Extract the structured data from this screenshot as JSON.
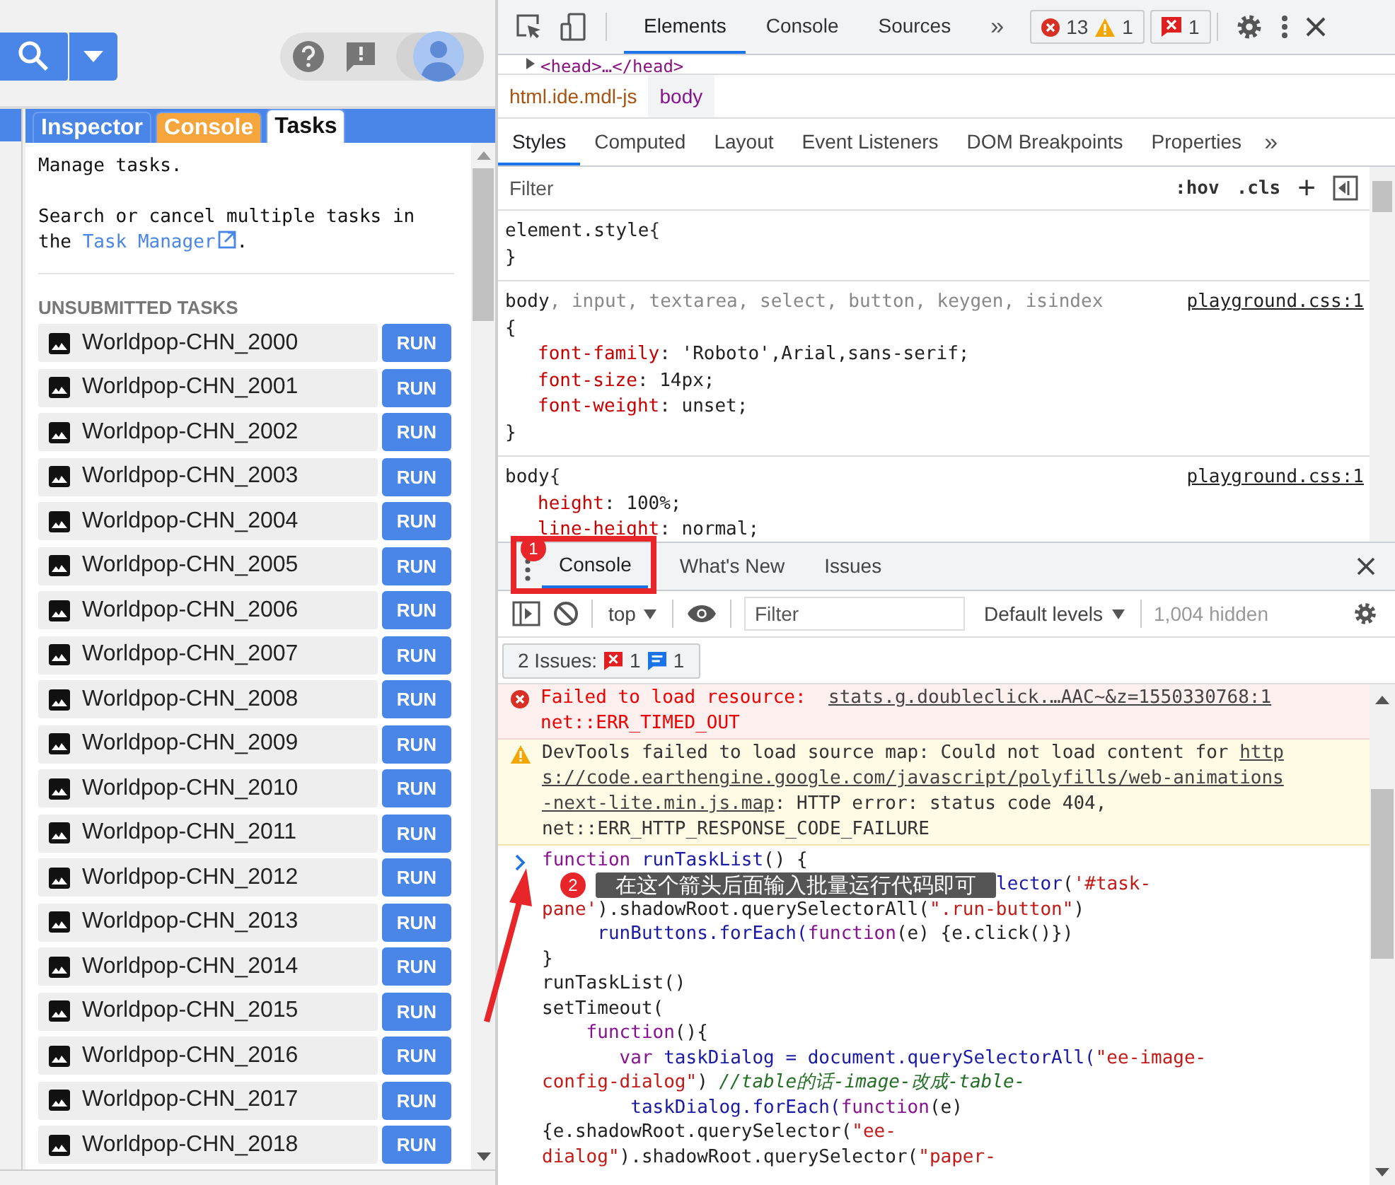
{
  "left_panel": {
    "tabs": [
      {
        "label": "Inspector",
        "selected": false,
        "color": "#4a86e8"
      },
      {
        "label": "Console",
        "selected": false,
        "color": "#f6a43c"
      },
      {
        "label": "Tasks",
        "selected": true,
        "color": "#ffffff"
      }
    ],
    "intro": "Manage tasks.",
    "manager_text": "Search or cancel multiple tasks in the ",
    "manager_link": "Task Manager",
    "manager_end": ".",
    "section_title": "UNSUBMITTED TASKS",
    "tasks": [
      {
        "name": "Worldpop-CHN_2000",
        "button": "RUN"
      },
      {
        "name": "Worldpop-CHN_2001",
        "button": "RUN"
      },
      {
        "name": "Worldpop-CHN_2002",
        "button": "RUN"
      },
      {
        "name": "Worldpop-CHN_2003",
        "button": "RUN"
      },
      {
        "name": "Worldpop-CHN_2004",
        "button": "RUN"
      },
      {
        "name": "Worldpop-CHN_2005",
        "button": "RUN"
      },
      {
        "name": "Worldpop-CHN_2006",
        "button": "RUN"
      },
      {
        "name": "Worldpop-CHN_2007",
        "button": "RUN"
      },
      {
        "name": "Worldpop-CHN_2008",
        "button": "RUN"
      },
      {
        "name": "Worldpop-CHN_2009",
        "button": "RUN"
      },
      {
        "name": "Worldpop-CHN_2010",
        "button": "RUN"
      },
      {
        "name": "Worldpop-CHN_2011",
        "button": "RUN"
      },
      {
        "name": "Worldpop-CHN_2012",
        "button": "RUN"
      },
      {
        "name": "Worldpop-CHN_2013",
        "button": "RUN"
      },
      {
        "name": "Worldpop-CHN_2014",
        "button": "RUN"
      },
      {
        "name": "Worldpop-CHN_2015",
        "button": "RUN"
      },
      {
        "name": "Worldpop-CHN_2016",
        "button": "RUN"
      },
      {
        "name": "Worldpop-CHN_2017",
        "button": "RUN"
      },
      {
        "name": "Worldpop-CHN_2018",
        "button": "RUN"
      }
    ]
  },
  "devtools": {
    "tabs": [
      {
        "label": "Elements",
        "selected": true
      },
      {
        "label": "Console",
        "selected": false
      },
      {
        "label": "Sources",
        "selected": false
      }
    ],
    "more": "»",
    "error_count": "13",
    "warning_count": "1",
    "issue_count": "1",
    "dom_line": "<head>…</head>",
    "breadcrumbs": [
      {
        "label": "html.ide.mdl-js",
        "selected": false
      },
      {
        "label": "body",
        "selected": true
      }
    ],
    "style_tabs": [
      {
        "label": "Styles",
        "selected": true
      },
      {
        "label": "Computed",
        "selected": false
      },
      {
        "label": "Layout",
        "selected": false
      },
      {
        "label": "Event Listeners",
        "selected": false
      },
      {
        "label": "DOM Breakpoints",
        "selected": false
      },
      {
        "label": "Properties",
        "selected": false
      }
    ],
    "style_more": "»",
    "filter_placeholder": "Filter",
    "hov": ":hov",
    "cls": ".cls",
    "plus": "+",
    "rules": [
      {
        "selector": "element.style",
        "open": " {",
        "brace_wrap": false,
        "close": "}"
      },
      {
        "selector": "body",
        "others": ", input, textarea, select, button, keygen, isindex",
        "open": "{",
        "brace_wrap": true,
        "source": "playground.css:1",
        "props": [
          {
            "name": "font-family",
            "value": ": 'Roboto',Arial,sans-serif;"
          },
          {
            "name": "font-size",
            "value": ": 14px;"
          },
          {
            "name": "font-weight",
            "value": ": unset;"
          }
        ],
        "close": "}"
      },
      {
        "selector": "body",
        "open": " {",
        "brace_wrap": false,
        "source": "playground.css:1",
        "props": [
          {
            "name": "height",
            "value": ": 100%;"
          },
          {
            "name": "line-height",
            "value": ": normal;"
          }
        ]
      }
    ]
  },
  "drawer": {
    "tabs": [
      {
        "label": "Console",
        "selected": true
      },
      {
        "label": "What's New",
        "selected": false
      },
      {
        "label": "Issues",
        "selected": false
      }
    ],
    "context": "top",
    "filter_placeholder": "Filter",
    "levels": "Default levels",
    "hidden": "1,004 hidden",
    "issues_label": "2 Issues:",
    "issues_errors": "1",
    "issues_info": "1",
    "messages": [
      {
        "kind": "error",
        "lines": [
          [
            {
              "text": "Failed to load resource:  ",
              "link": false
            },
            {
              "text": "stats.g.doubleclick.…AAC~&z=1550330768:1",
              "link": true
            }
          ],
          [
            {
              "text": "net::ERR_TIMED_OUT",
              "link": false
            }
          ]
        ]
      },
      {
        "kind": "warning",
        "lines": [
          [
            {
              "text": "DevTools failed to load source map: Could not load content for ",
              "link": false
            },
            {
              "text": "http",
              "link": true
            }
          ],
          [
            {
              "text": "s://code.earthengine.google.com/javascript/polyfills/web-animations",
              "link": true
            }
          ],
          [
            {
              "text": "-next-lite.min.js.map",
              "link": true
            },
            {
              "text": ": HTTP error: status code 404,",
              "link": false
            }
          ],
          [
            {
              "text": "net::ERR_HTTP_RESPONSE_CODE_FAILURE",
              "link": false
            }
          ]
        ]
      }
    ],
    "code": [
      {
        "segs": [
          {
            "kind": "keyword",
            "t": "function"
          },
          {
            "kind": "name",
            "t": " runTaskList"
          },
          {
            "kind": "plain",
            "t": "() {"
          }
        ]
      },
      {
        "badge": "2",
        "note": "在这个箭头后面输入批量运行代码即可",
        "segs": [
          {
            "kind": "name",
            "t": "lector"
          },
          {
            "kind": "plain",
            "t": "("
          },
          {
            "kind": "string",
            "t": "'#task-"
          }
        ]
      },
      {
        "segs": [
          {
            "kind": "string",
            "t": "pane'"
          },
          {
            "kind": "plain",
            "t": ").shadowRoot.querySelectorAll("
          },
          {
            "kind": "string",
            "t": "\".run-button\""
          },
          {
            "kind": "plain",
            "t": ")"
          }
        ]
      },
      {
        "segs": [
          {
            "kind": "name",
            "t": "     runButtons.forEach("
          },
          {
            "kind": "keyword",
            "t": "function"
          },
          {
            "kind": "plain",
            "t": "(e) {e.click()})"
          }
        ]
      },
      {
        "segs": [
          {
            "kind": "plain",
            "t": "}"
          }
        ]
      },
      {
        "segs": [
          {
            "kind": "plain",
            "t": "runTaskList()"
          }
        ]
      },
      {
        "segs": [
          {
            "kind": "plain",
            "t": "setTimeout("
          }
        ]
      },
      {
        "segs": [
          {
            "kind": "keyword",
            "t": "    function"
          },
          {
            "kind": "plain",
            "t": "(){"
          }
        ]
      },
      {
        "segs": [
          {
            "kind": "keyword",
            "t": "       var"
          },
          {
            "kind": "name",
            "t": " taskDialog = document.querySelectorAll("
          },
          {
            "kind": "string",
            "t": "\"ee-image-"
          }
        ]
      },
      {
        "segs": [
          {
            "kind": "string",
            "t": "config-dialog\""
          },
          {
            "kind": "plain",
            "t": ") "
          },
          {
            "kind": "comment",
            "t": "//table的话-image-改成-table-"
          }
        ]
      },
      {
        "segs": [
          {
            "kind": "name",
            "t": "        taskDialog.forEach("
          },
          {
            "kind": "keyword",
            "t": "function"
          },
          {
            "kind": "plain",
            "t": "(e)"
          }
        ]
      },
      {
        "segs": [
          {
            "kind": "plain",
            "t": "{e.shadowRoot.querySelector("
          },
          {
            "kind": "string",
            "t": "\"ee-"
          }
        ]
      },
      {
        "segs": [
          {
            "kind": "string",
            "t": "dialog\""
          },
          {
            "kind": "plain",
            "t": ").shadowRoot.querySelector("
          },
          {
            "kind": "string",
            "t": "\"paper-"
          }
        ]
      }
    ]
  },
  "annotations": {
    "box_badge": "1"
  }
}
